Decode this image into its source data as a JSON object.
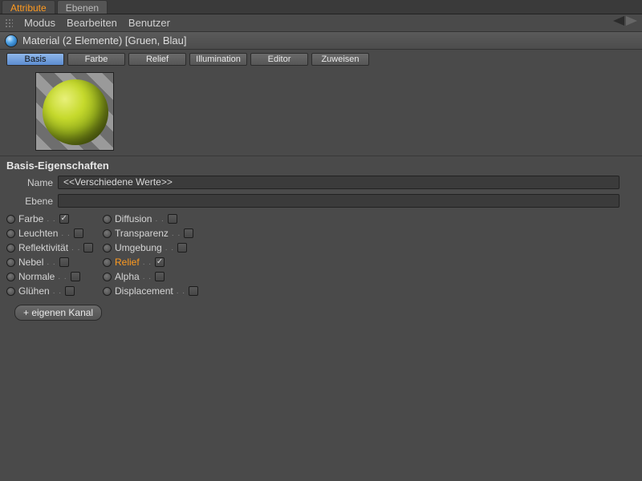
{
  "topTabs": {
    "attribute": "Attribute",
    "ebenen": "Ebenen",
    "active": "attribute"
  },
  "menu": {
    "modus": "Modus",
    "bearbeiten": "Bearbeiten",
    "benutzer": "Benutzer"
  },
  "material": {
    "title": "Material (2 Elemente) [Gruen, Blau]"
  },
  "subTabs": {
    "basis": "Basis",
    "farbe": "Farbe",
    "relief": "Relief",
    "illumination": "Illumination",
    "editor": "Editor",
    "zuweisen": "Zuweisen",
    "active": "basis"
  },
  "section": {
    "label": "Basis-Eigenschaften"
  },
  "fields": {
    "nameLabel": "Name",
    "nameValue": "<<Verschiedene Werte>>",
    "ebeneLabel": "Ebene",
    "ebeneValue": ""
  },
  "channels": {
    "col1": [
      {
        "key": "farbe",
        "label": "Farbe",
        "checked": true,
        "hot": false
      },
      {
        "key": "leuchten",
        "label": "Leuchten",
        "checked": false,
        "hot": false
      },
      {
        "key": "reflektivitaet",
        "label": "Reflektivität",
        "checked": false,
        "hot": false
      },
      {
        "key": "nebel",
        "label": "Nebel",
        "checked": false,
        "hot": false
      },
      {
        "key": "normale",
        "label": "Normale",
        "checked": false,
        "hot": false
      },
      {
        "key": "gluehen",
        "label": "Glühen",
        "checked": false,
        "hot": false
      }
    ],
    "col2": [
      {
        "key": "diffusion",
        "label": "Diffusion",
        "checked": false,
        "hot": false
      },
      {
        "key": "transparenz",
        "label": "Transparenz",
        "checked": false,
        "hot": false
      },
      {
        "key": "umgebung",
        "label": "Umgebung",
        "checked": false,
        "hot": false
      },
      {
        "key": "relief",
        "label": "Relief",
        "checked": true,
        "hot": true
      },
      {
        "key": "alpha",
        "label": "Alpha",
        "checked": false,
        "hot": false
      },
      {
        "key": "displacement",
        "label": "Displacement",
        "checked": false,
        "hot": false
      }
    ]
  },
  "addChannel": {
    "label": "+ eigenen Kanal"
  }
}
